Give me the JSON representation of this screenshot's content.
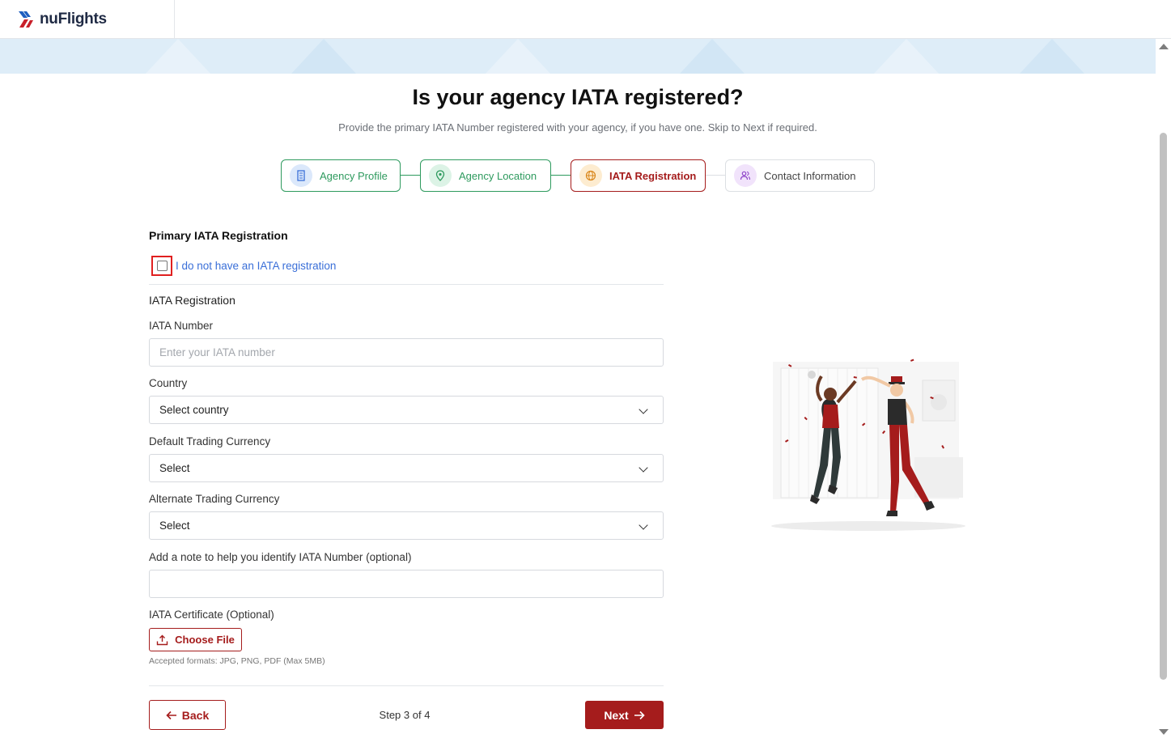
{
  "brand": {
    "name": "nuFlights"
  },
  "header": {
    "title": "Is your agency IATA registered?",
    "subtitle": "Provide the primary IATA Number registered with your agency, if you have one. Skip to Next if required."
  },
  "steps": [
    {
      "label": "Agency Profile",
      "state": "done",
      "icon": "building-icon"
    },
    {
      "label": "Agency Location",
      "state": "done",
      "icon": "map-pin-icon"
    },
    {
      "label": "IATA Registration",
      "state": "active",
      "icon": "globe-icon"
    },
    {
      "label": "Contact Information",
      "state": "todo",
      "icon": "users-icon"
    }
  ],
  "form": {
    "section_title": "Primary IATA Registration",
    "no_iata_label": "I do not have an IATA registration",
    "no_iata_checked": false,
    "subsection_title": "IATA Registration",
    "iata_number": {
      "label": "IATA Number",
      "placeholder": "Enter your IATA number",
      "value": ""
    },
    "country": {
      "label": "Country",
      "value": "Select country"
    },
    "default_currency": {
      "label": "Default Trading Currency",
      "value": "Select"
    },
    "alternate_currency": {
      "label": "Alternate Trading Currency",
      "value": "Select"
    },
    "note": {
      "label": "Add a note to help you identify IATA Number (optional)",
      "value": ""
    },
    "certificate": {
      "label": "IATA Certificate (Optional)",
      "button_label": "Choose File",
      "hint": "Accepted formats: JPG, PNG, PDF (Max 5MB)"
    }
  },
  "footer": {
    "back_label": "Back",
    "step_text": "Step 3 of 4",
    "next_label": "Next"
  },
  "colors": {
    "brand_red": "#a51c1c",
    "success_green": "#2e9a5e",
    "link_blue": "#3a6fd8",
    "banner_blue": "#deedf8"
  }
}
